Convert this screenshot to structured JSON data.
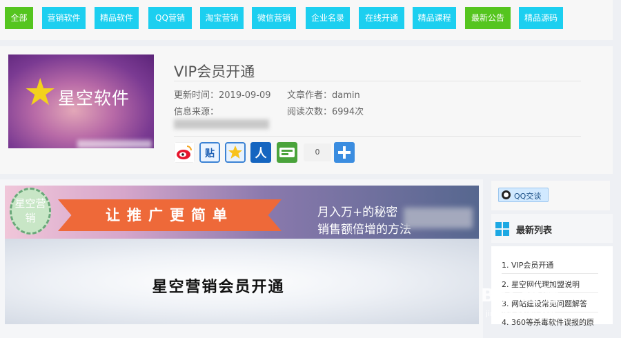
{
  "nav": {
    "items": [
      {
        "label": "全部",
        "active": true
      },
      {
        "label": "营销软件"
      },
      {
        "label": "精品软件"
      },
      {
        "label": "QQ营销"
      },
      {
        "label": "淘宝营销"
      },
      {
        "label": "微信营销"
      },
      {
        "label": "企业名录"
      },
      {
        "label": "在线开通"
      },
      {
        "label": "精品课程"
      },
      {
        "label": "最新公告",
        "active": true
      },
      {
        "label": "精品源码"
      }
    ]
  },
  "article": {
    "thumb_text": "星空软件",
    "title": "VIP会员开通",
    "update_label": "更新时间：",
    "update_value": "2019-09-09",
    "author_label": "文章作者：",
    "author_value": "damin",
    "source_label": "信息来源：",
    "views_label": "阅读次数：",
    "views_value": "6994次",
    "share_count": "0",
    "share_icons": [
      "weibo-icon",
      "tieba-icon",
      "qzone-icon",
      "renren-icon",
      "pengyou-icon",
      "plus-icon"
    ]
  },
  "banner": {
    "badge_text": "星空营销",
    "ribbon_text": "让推广更简单",
    "pitch_line1": "月入万+的秘密",
    "pitch_line2": "销售额倍增的方法",
    "caption": "星空营销会员开通"
  },
  "sidebar": {
    "qq_label": "QQ交谈",
    "list_title": "最新列表",
    "items": [
      "1. VIP会员开通",
      "2. 星空网代理加盟说明",
      "3. 网站建设常见问题解答",
      "4. 360等杀毒软件误报的原"
    ]
  },
  "watermark": {
    "text": "Bai 经验",
    "sub": "jingyan.baidu.com"
  },
  "colors": {
    "nav_cyan": "#1ccff0",
    "nav_green": "#55c51f",
    "ribbon": "#ee6939",
    "sidebar_icon": "#1ca8e3"
  }
}
